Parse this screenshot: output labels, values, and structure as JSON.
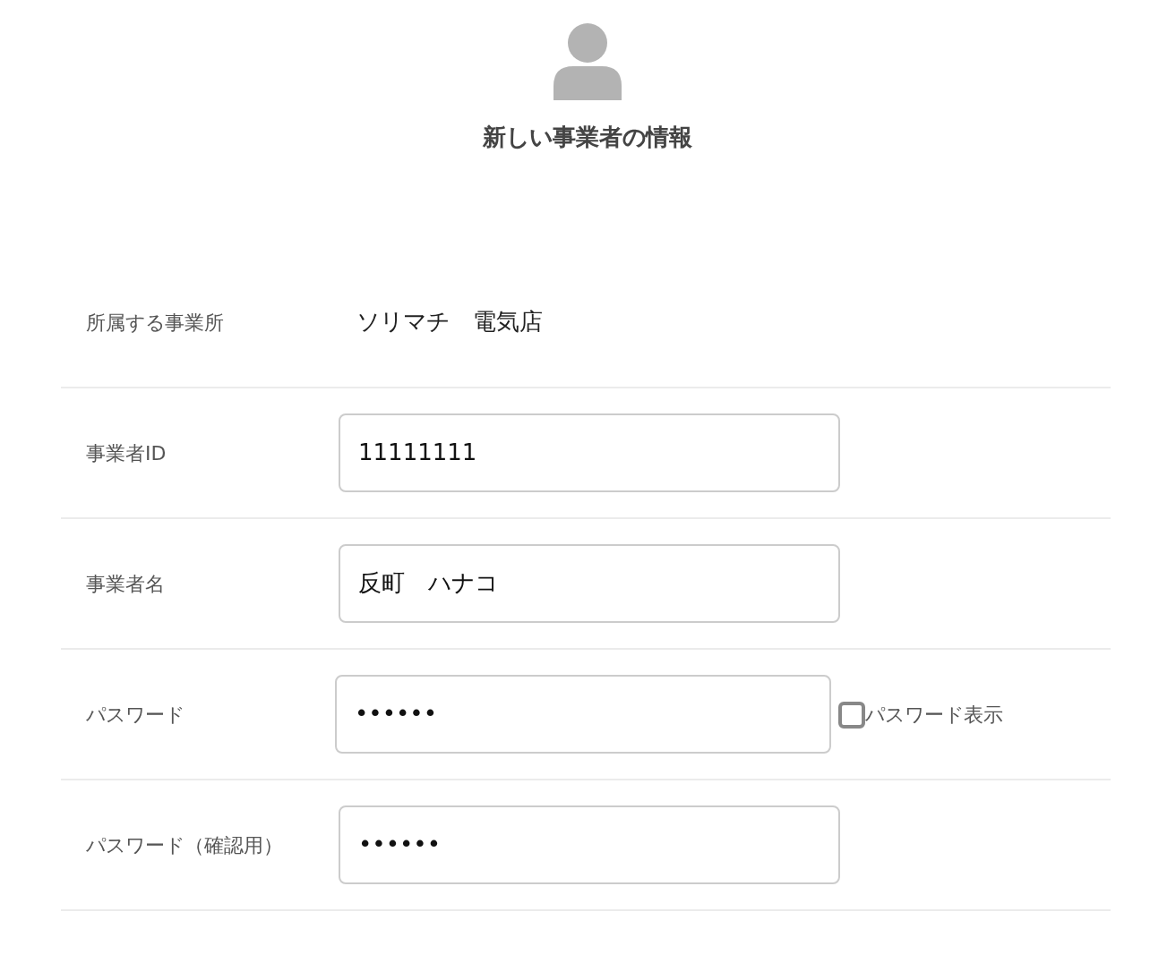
{
  "header": {
    "title": "新しい事業者の情報"
  },
  "rows": [
    {
      "kind": "static",
      "label": "所属する事業所",
      "value": "ソリマチ　電気店"
    },
    {
      "kind": "input",
      "label": "事業者ID",
      "value": "11111111"
    },
    {
      "kind": "input",
      "label": "事業者名",
      "value": "反町　ハナコ"
    },
    {
      "kind": "password",
      "label": "パスワード",
      "value": "••••••",
      "toggle": {
        "label": "パスワード表示",
        "checked": false
      }
    },
    {
      "kind": "input",
      "label": "パスワード（確認用）",
      "value": "••••••"
    }
  ]
}
